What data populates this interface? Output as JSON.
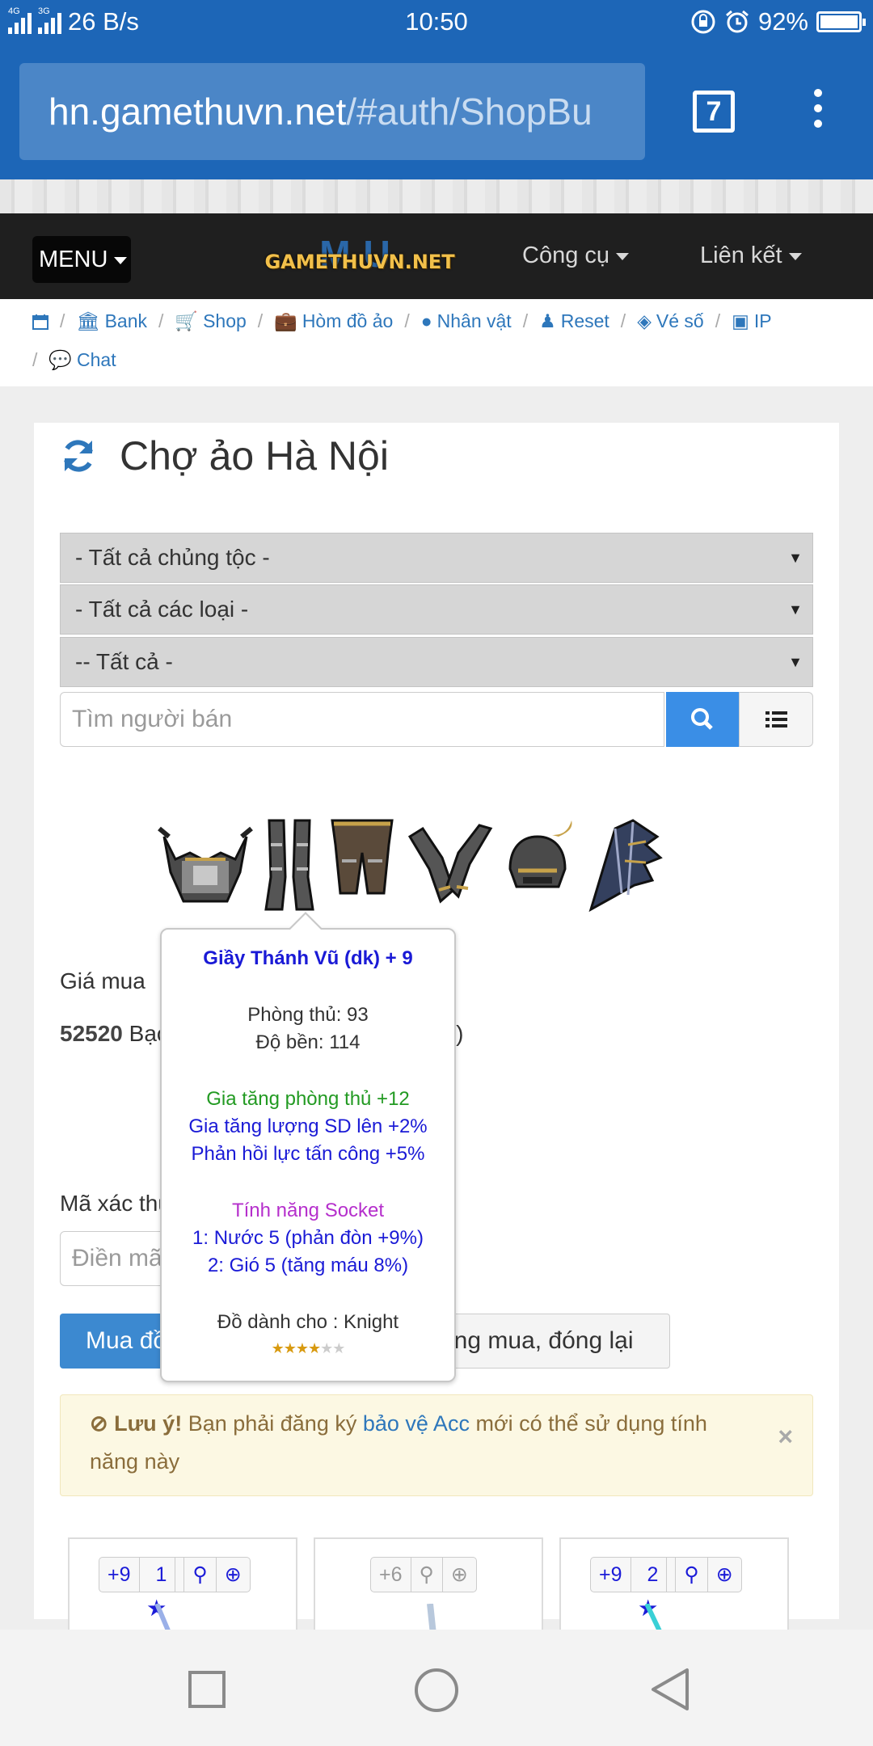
{
  "status": {
    "net_left": "4G",
    "net_right": "3G",
    "speed": "26 B/s",
    "time": "10:50",
    "battery": "92%",
    "battery_level": 0.92
  },
  "browser": {
    "url_host": "hn.gamethuvn.net",
    "url_path": "/#auth/ShopBu",
    "tab_count": "7"
  },
  "navbar": {
    "menu_label": "MENU",
    "logo_big": "MU",
    "logo_text": "GAMETHUVN.NET",
    "tools_label": "Công cụ",
    "links_label": "Liên kết"
  },
  "breadcrumb": [
    {
      "label": "Bank",
      "icon": "bank-icon"
    },
    {
      "label": "Shop",
      "icon": "cart-icon"
    },
    {
      "label": "Hòm đồ ảo",
      "icon": "suitcase-icon"
    },
    {
      "label": "Nhân vật",
      "icon": "user-icon"
    },
    {
      "label": "Reset",
      "icon": "reset-user-icon"
    },
    {
      "label": "Vé số",
      "icon": "ticket-icon"
    },
    {
      "label": "IP",
      "icon": "lock-icon"
    },
    {
      "label": "Chat",
      "icon": "chat-icon"
    }
  ],
  "page": {
    "title": "Chợ ảo Hà Nội"
  },
  "filters": {
    "race": "- Tất cả chủng tộc -",
    "type": "- Tất cả các loại -",
    "all": "-- Tất cả -",
    "seller_placeholder": "Tìm người bán"
  },
  "purchase": {
    "price_label": "Giá mua",
    "price_value": "52520",
    "price_unit": "Bạc",
    "price_suffix": "bạc)",
    "code_label": "Mã xác thu",
    "code_placeholder": "Điền mã",
    "buy_label": "Mua đồ",
    "close_label": "ông mua, đóng lại"
  },
  "alert": {
    "title": "Lưu ý!",
    "text_before": " Bạn phải đăng ký ",
    "link": "bảo vệ Acc",
    "text_after": " mới có thể sử dụng tính năng này",
    "close": "×"
  },
  "tooltip": {
    "name": "Giầy Thánh Vũ (dk) + 9",
    "defense": "Phòng thủ: 93",
    "durability": "Độ bền: 114",
    "opt1": "Gia tăng phòng thủ +12",
    "opt2": "Gia tăng lượng SD lên +2%",
    "opt3": "Phản hồi lực tấn công +5%",
    "socket_title": "Tính năng Socket",
    "socket1": "1: Nước 5 (phản đòn +9%)",
    "socket2": "2: Gió 5 (tăng máu 8%)",
    "for_class": "Đồ dành cho : Knight",
    "rating": 4,
    "rating_max": 6
  },
  "cards": [
    {
      "level": "+9",
      "stars": "1"
    },
    {
      "level": "+6",
      "stars": ""
    },
    {
      "level": "+9",
      "stars": "2"
    }
  ],
  "colors": {
    "primary": "#1d66b7",
    "link": "#2e77bb",
    "button": "#3a8ee6",
    "alert_bg": "#fcf8e3"
  }
}
